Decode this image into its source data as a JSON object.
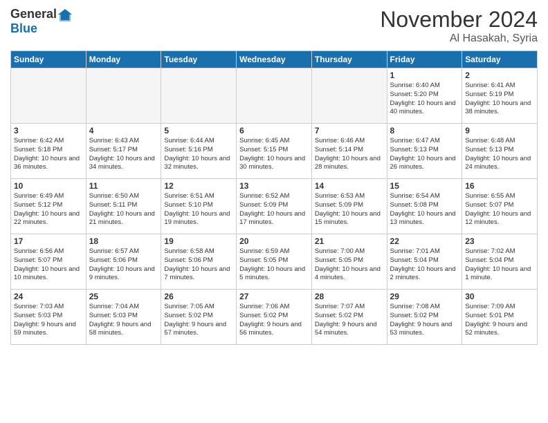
{
  "header": {
    "logo": {
      "general": "General",
      "blue": "Blue"
    },
    "title": "November 2024",
    "location": "Al Hasakah, Syria"
  },
  "days_of_week": [
    "Sunday",
    "Monday",
    "Tuesday",
    "Wednesday",
    "Thursday",
    "Friday",
    "Saturday"
  ],
  "weeks": [
    [
      {
        "day": "",
        "empty": true
      },
      {
        "day": "",
        "empty": true
      },
      {
        "day": "",
        "empty": true
      },
      {
        "day": "",
        "empty": true
      },
      {
        "day": "",
        "empty": true
      },
      {
        "day": "1",
        "sunrise": "6:40 AM",
        "sunset": "5:20 PM",
        "daylight": "10 hours and 40 minutes."
      },
      {
        "day": "2",
        "sunrise": "6:41 AM",
        "sunset": "5:19 PM",
        "daylight": "10 hours and 38 minutes."
      }
    ],
    [
      {
        "day": "3",
        "sunrise": "6:42 AM",
        "sunset": "5:18 PM",
        "daylight": "10 hours and 36 minutes."
      },
      {
        "day": "4",
        "sunrise": "6:43 AM",
        "sunset": "5:17 PM",
        "daylight": "10 hours and 34 minutes."
      },
      {
        "day": "5",
        "sunrise": "6:44 AM",
        "sunset": "5:16 PM",
        "daylight": "10 hours and 32 minutes."
      },
      {
        "day": "6",
        "sunrise": "6:45 AM",
        "sunset": "5:15 PM",
        "daylight": "10 hours and 30 minutes."
      },
      {
        "day": "7",
        "sunrise": "6:46 AM",
        "sunset": "5:14 PM",
        "daylight": "10 hours and 28 minutes."
      },
      {
        "day": "8",
        "sunrise": "6:47 AM",
        "sunset": "5:13 PM",
        "daylight": "10 hours and 26 minutes."
      },
      {
        "day": "9",
        "sunrise": "6:48 AM",
        "sunset": "5:13 PM",
        "daylight": "10 hours and 24 minutes."
      }
    ],
    [
      {
        "day": "10",
        "sunrise": "6:49 AM",
        "sunset": "5:12 PM",
        "daylight": "10 hours and 22 minutes."
      },
      {
        "day": "11",
        "sunrise": "6:50 AM",
        "sunset": "5:11 PM",
        "daylight": "10 hours and 21 minutes."
      },
      {
        "day": "12",
        "sunrise": "6:51 AM",
        "sunset": "5:10 PM",
        "daylight": "10 hours and 19 minutes."
      },
      {
        "day": "13",
        "sunrise": "6:52 AM",
        "sunset": "5:09 PM",
        "daylight": "10 hours and 17 minutes."
      },
      {
        "day": "14",
        "sunrise": "6:53 AM",
        "sunset": "5:09 PM",
        "daylight": "10 hours and 15 minutes."
      },
      {
        "day": "15",
        "sunrise": "6:54 AM",
        "sunset": "5:08 PM",
        "daylight": "10 hours and 13 minutes."
      },
      {
        "day": "16",
        "sunrise": "6:55 AM",
        "sunset": "5:07 PM",
        "daylight": "10 hours and 12 minutes."
      }
    ],
    [
      {
        "day": "17",
        "sunrise": "6:56 AM",
        "sunset": "5:07 PM",
        "daylight": "10 hours and 10 minutes."
      },
      {
        "day": "18",
        "sunrise": "6:57 AM",
        "sunset": "5:06 PM",
        "daylight": "10 hours and 9 minutes."
      },
      {
        "day": "19",
        "sunrise": "6:58 AM",
        "sunset": "5:06 PM",
        "daylight": "10 hours and 7 minutes."
      },
      {
        "day": "20",
        "sunrise": "6:59 AM",
        "sunset": "5:05 PM",
        "daylight": "10 hours and 5 minutes."
      },
      {
        "day": "21",
        "sunrise": "7:00 AM",
        "sunset": "5:05 PM",
        "daylight": "10 hours and 4 minutes."
      },
      {
        "day": "22",
        "sunrise": "7:01 AM",
        "sunset": "5:04 PM",
        "daylight": "10 hours and 2 minutes."
      },
      {
        "day": "23",
        "sunrise": "7:02 AM",
        "sunset": "5:04 PM",
        "daylight": "10 hours and 1 minute."
      }
    ],
    [
      {
        "day": "24",
        "sunrise": "7:03 AM",
        "sunset": "5:03 PM",
        "daylight": "9 hours and 59 minutes."
      },
      {
        "day": "25",
        "sunrise": "7:04 AM",
        "sunset": "5:03 PM",
        "daylight": "9 hours and 58 minutes."
      },
      {
        "day": "26",
        "sunrise": "7:05 AM",
        "sunset": "5:02 PM",
        "daylight": "9 hours and 57 minutes."
      },
      {
        "day": "27",
        "sunrise": "7:06 AM",
        "sunset": "5:02 PM",
        "daylight": "9 hours and 56 minutes."
      },
      {
        "day": "28",
        "sunrise": "7:07 AM",
        "sunset": "5:02 PM",
        "daylight": "9 hours and 54 minutes."
      },
      {
        "day": "29",
        "sunrise": "7:08 AM",
        "sunset": "5:02 PM",
        "daylight": "9 hours and 53 minutes."
      },
      {
        "day": "30",
        "sunrise": "7:09 AM",
        "sunset": "5:01 PM",
        "daylight": "9 hours and 52 minutes."
      }
    ]
  ]
}
